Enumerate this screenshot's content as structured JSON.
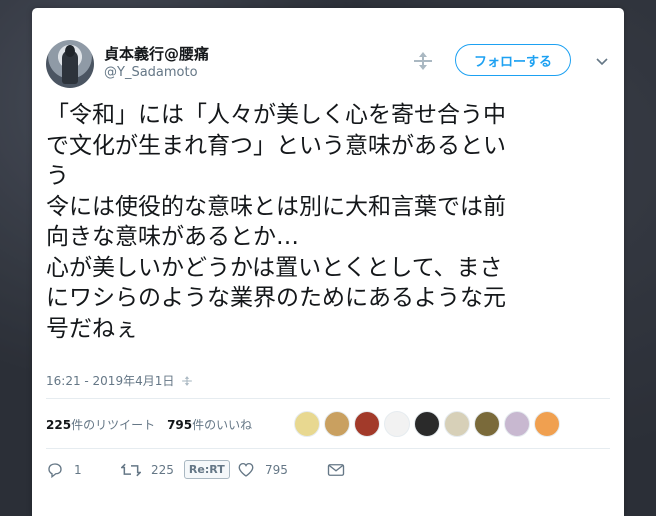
{
  "colors": {
    "accent": "#1da1f2",
    "text": "#14171a",
    "muted": "#657786"
  },
  "user": {
    "display_name": "貞本義行@腰痛",
    "handle": "@Y_Sadamoto"
  },
  "header": {
    "follow_label": "フォローする"
  },
  "tweet": {
    "text": "「令和」には「人々が美しく心を寄せ合う中\nで文化が生まれ育つ」という意味があるとい\nう\n令には使役的な意味とは別に大和言葉では前\n向きな意味があるとか…\n心が美しいかどうかは置いとくとして、まさ\nにワシらのような業界のためにあるような元\n号だねぇ"
  },
  "meta": {
    "timestamp": "16:21 - 2019年4月1日"
  },
  "stats": {
    "retweet_count": "225",
    "retweet_label": "件のリツイート",
    "like_count": "795",
    "like_label": "件のいいね"
  },
  "actions": {
    "reply_count": "1",
    "retweet_count": "225",
    "rert_label": "Re:RT",
    "like_count": "795"
  },
  "likers": [
    {
      "color": "#e8d890"
    },
    {
      "color": "#c9a060"
    },
    {
      "color": "#a23a2a"
    },
    {
      "color": "#f2f2f2"
    },
    {
      "color": "#2a2a2a"
    },
    {
      "color": "#d7d0b8"
    },
    {
      "color": "#7a6a3a"
    },
    {
      "color": "#c8b8d0"
    },
    {
      "color": "#f0a050"
    }
  ]
}
